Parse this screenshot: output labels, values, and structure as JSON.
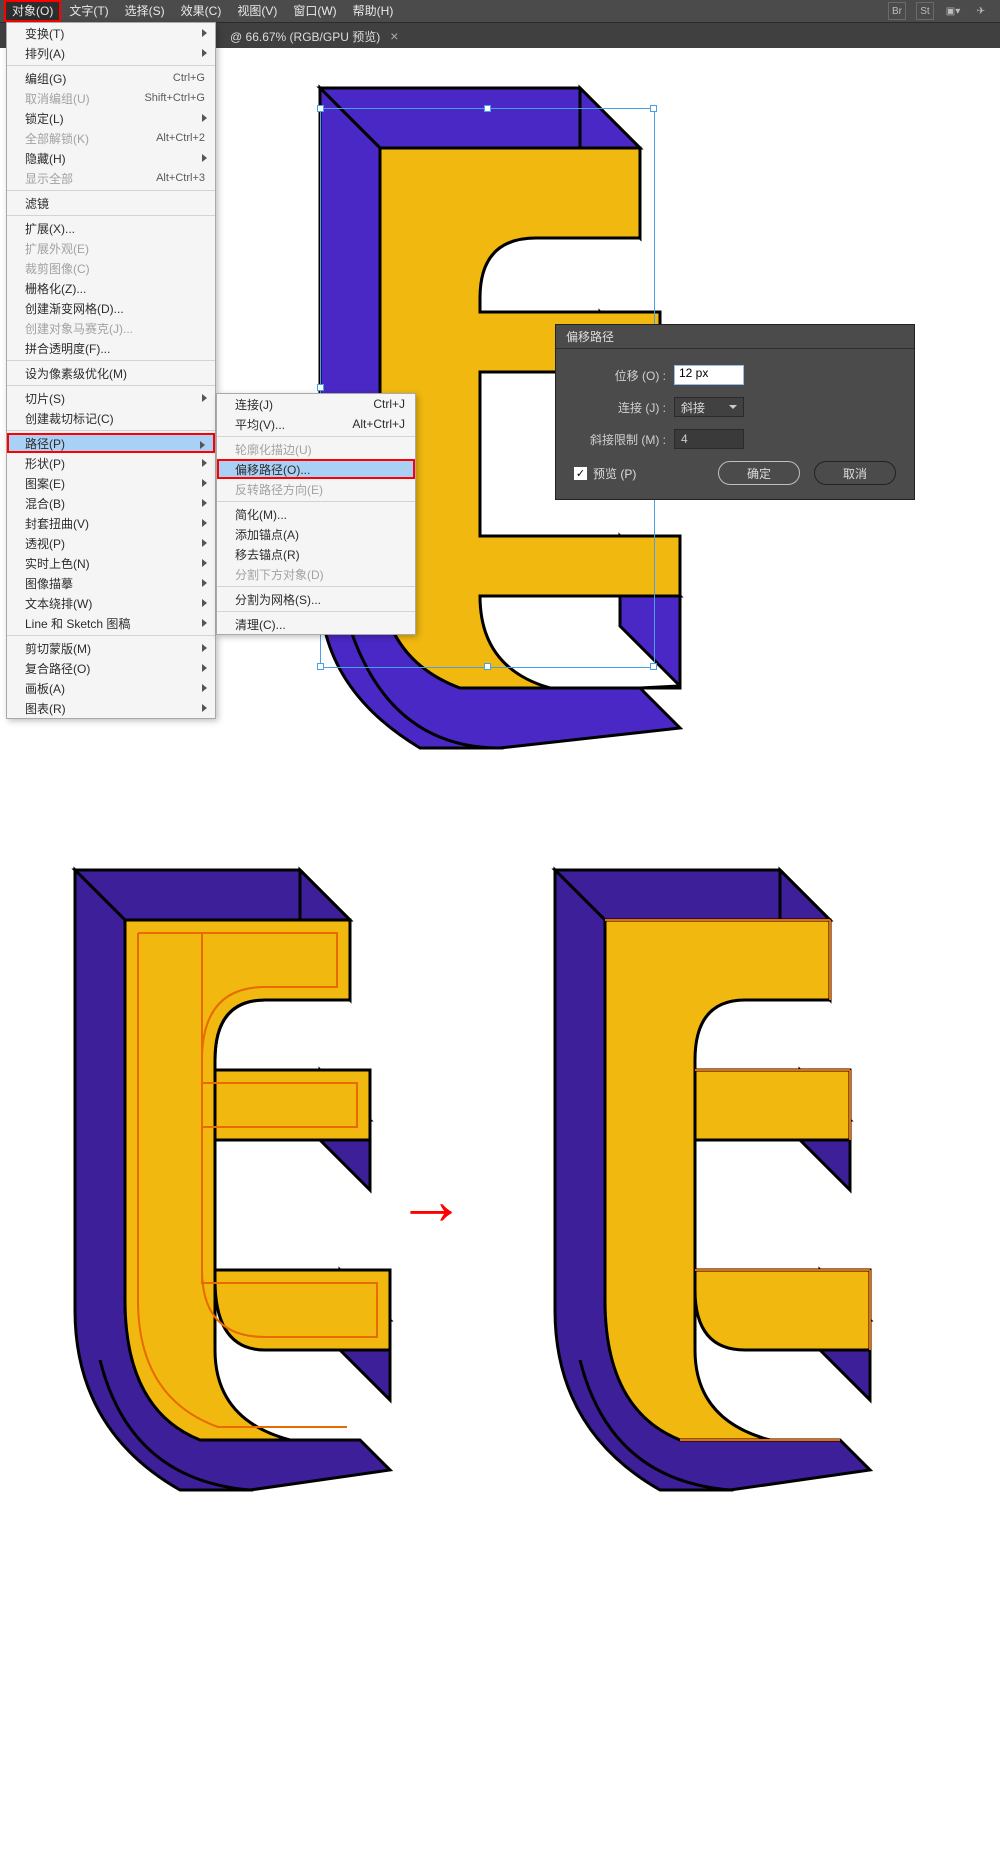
{
  "menubar": {
    "items": [
      "对象(O)",
      "文字(T)",
      "选择(S)",
      "效果(C)",
      "视图(V)",
      "窗口(W)",
      "帮助(H)"
    ],
    "active_index": 0
  },
  "tabbar": {
    "tab_label": "@ 66.67% (RGB/GPU 预览)",
    "close": "×"
  },
  "dropdown": {
    "groups": [
      [
        {
          "label": "变换(T)",
          "arrow": true
        },
        {
          "label": "排列(A)",
          "arrow": true
        }
      ],
      [
        {
          "label": "编组(G)",
          "shortcut": "Ctrl+G"
        },
        {
          "label": "取消编组(U)",
          "shortcut": "Shift+Ctrl+G",
          "disabled": true
        },
        {
          "label": "锁定(L)",
          "arrow": true
        },
        {
          "label": "全部解锁(K)",
          "shortcut": "Alt+Ctrl+2",
          "disabled": true
        },
        {
          "label": "隐藏(H)",
          "arrow": true
        },
        {
          "label": "显示全部",
          "shortcut": "Alt+Ctrl+3",
          "disabled": true
        }
      ],
      [
        {
          "label": "滤镜"
        }
      ],
      [
        {
          "label": "扩展(X)..."
        },
        {
          "label": "扩展外观(E)",
          "disabled": true
        },
        {
          "label": "裁剪图像(C)",
          "disabled": true
        },
        {
          "label": "栅格化(Z)..."
        },
        {
          "label": "创建渐变网格(D)..."
        },
        {
          "label": "创建对象马赛克(J)...",
          "disabled": true
        },
        {
          "label": "拼合透明度(F)..."
        }
      ],
      [
        {
          "label": "设为像素级优化(M)"
        }
      ],
      [
        {
          "label": "切片(S)",
          "arrow": true
        },
        {
          "label": "创建裁切标记(C)"
        }
      ],
      [
        {
          "label": "路径(P)",
          "arrow": true,
          "highlight": true,
          "boxed": true
        },
        {
          "label": "形状(P)",
          "arrow": true
        },
        {
          "label": "图案(E)",
          "arrow": true
        },
        {
          "label": "混合(B)",
          "arrow": true
        },
        {
          "label": "封套扭曲(V)",
          "arrow": true
        },
        {
          "label": "透视(P)",
          "arrow": true
        },
        {
          "label": "实时上色(N)",
          "arrow": true
        },
        {
          "label": "图像描摹",
          "arrow": true
        },
        {
          "label": "文本绕排(W)",
          "arrow": true
        },
        {
          "label": "Line 和 Sketch 图稿",
          "arrow": true
        }
      ],
      [
        {
          "label": "剪切蒙版(M)",
          "arrow": true
        },
        {
          "label": "复合路径(O)",
          "arrow": true
        },
        {
          "label": "画板(A)",
          "arrow": true
        },
        {
          "label": "图表(R)",
          "arrow": true
        }
      ]
    ]
  },
  "submenu": {
    "groups": [
      [
        {
          "label": "连接(J)",
          "shortcut": "Ctrl+J"
        },
        {
          "label": "平均(V)...",
          "shortcut": "Alt+Ctrl+J"
        }
      ],
      [
        {
          "label": "轮廓化描边(U)",
          "disabled": true
        },
        {
          "label": "偏移路径(O)...",
          "highlight": true,
          "boxed": true
        },
        {
          "label": "反转路径方向(E)",
          "disabled": true
        }
      ],
      [
        {
          "label": "简化(M)..."
        },
        {
          "label": "添加锚点(A)"
        },
        {
          "label": "移去锚点(R)"
        },
        {
          "label": "分割下方对象(D)",
          "disabled": true
        }
      ],
      [
        {
          "label": "分割为网格(S)..."
        }
      ],
      [
        {
          "label": "清理(C)..."
        }
      ]
    ]
  },
  "dialog": {
    "title": "偏移路径",
    "offset_label": "位移 (O) :",
    "offset_value": "12 px",
    "join_label": "连接 (J) :",
    "join_value": "斜接",
    "miter_label": "斜接限制 (M) :",
    "miter_value": "4",
    "preview_label": "预览 (P)",
    "ok": "确定",
    "cancel": "取消"
  },
  "arrow_glyph": "→"
}
